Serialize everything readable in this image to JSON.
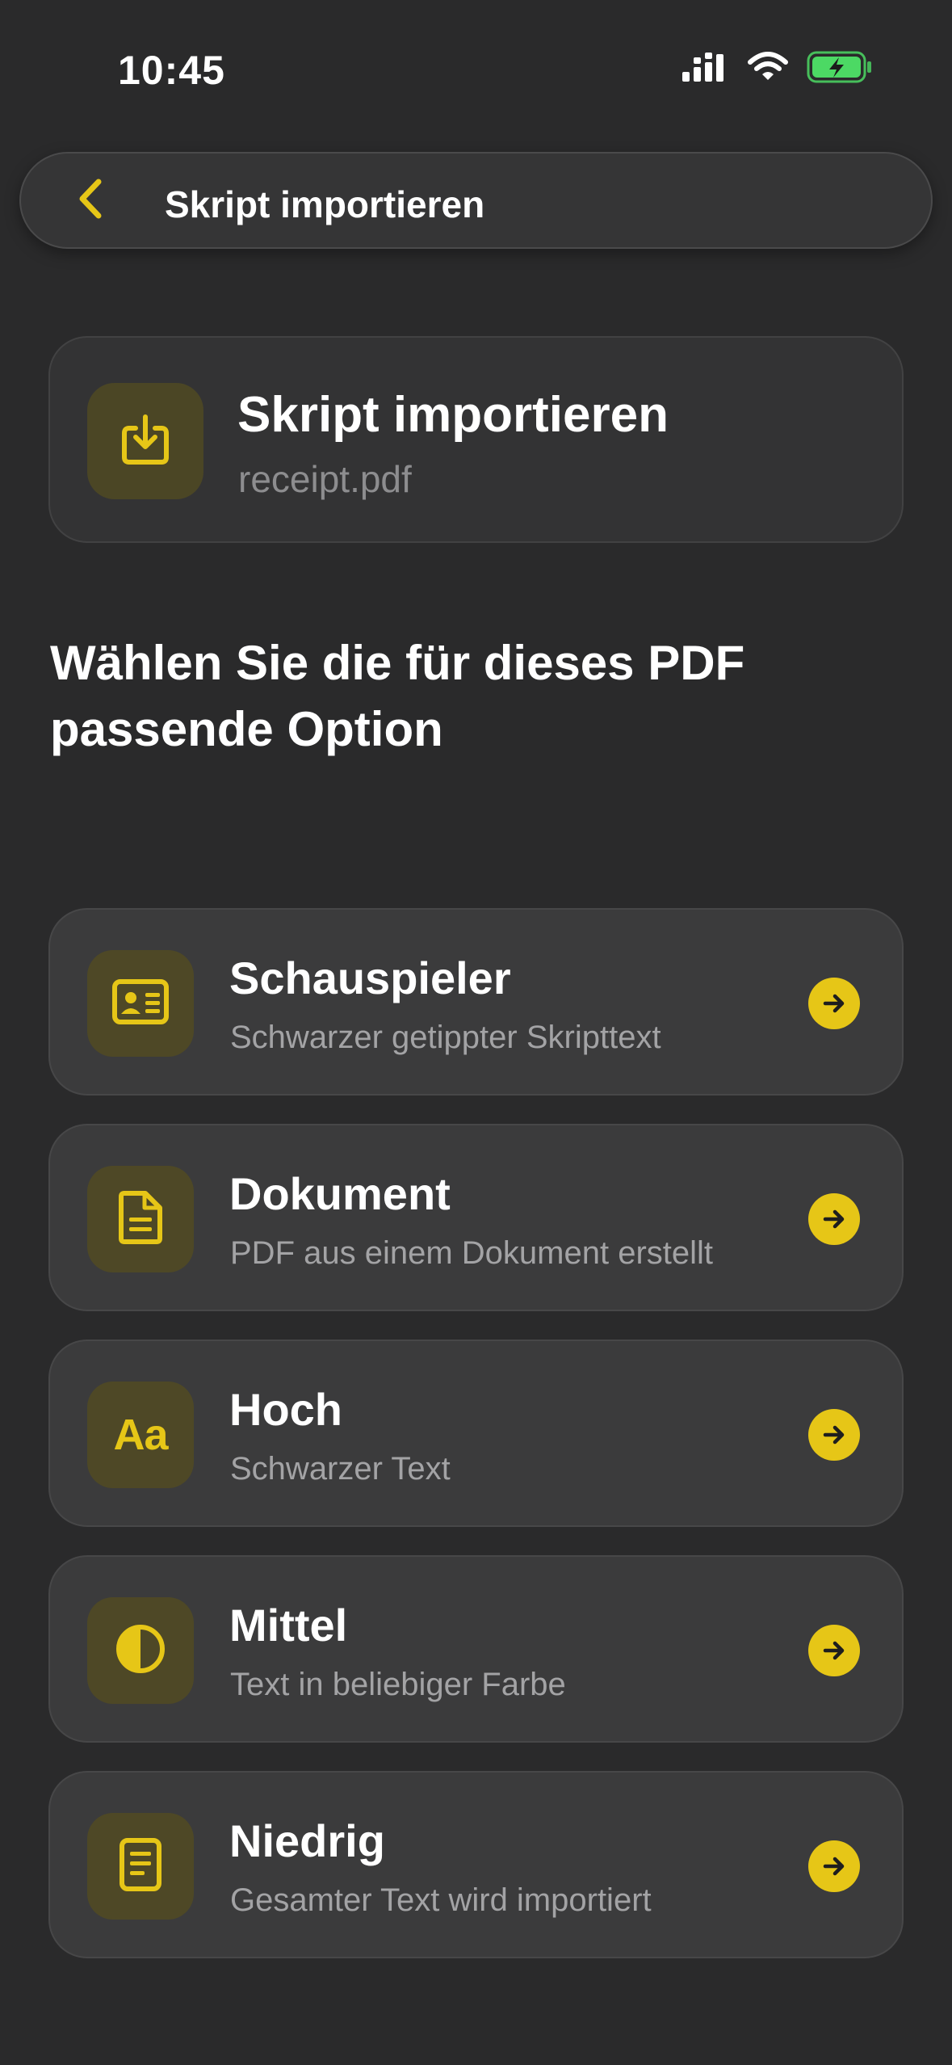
{
  "status_bar": {
    "time": "10:45"
  },
  "nav": {
    "title": "Skript importieren",
    "back_icon": "chevron-left-icon"
  },
  "file_card": {
    "title": "Skript importieren",
    "filename": "receipt.pdf",
    "icon": "import-download-icon"
  },
  "heading": "Wählen Sie die für dieses PDF passende Option",
  "options": [
    {
      "title": "Schauspieler",
      "subtitle": "Schwarzer getippter Skripttext",
      "icon": "id-card-icon"
    },
    {
      "title": "Dokument",
      "subtitle": "PDF aus einem Dokument erstellt",
      "icon": "document-icon"
    },
    {
      "title": "Hoch",
      "subtitle": "Schwarzer Text",
      "icon": "text-aa-icon",
      "icon_glyph": "Aa"
    },
    {
      "title": "Mittel",
      "subtitle": "Text in beliebiger Farbe",
      "icon": "contrast-icon"
    },
    {
      "title": "Niedrig",
      "subtitle": "Gesamter Text wird importiert",
      "icon": "page-lines-icon"
    }
  ],
  "colors": {
    "background": "#2a2a2b",
    "accent": "#e6c617",
    "card": "#3b3b3c",
    "icon_tile": "#4e4826",
    "subtitle": "#a3a3a5",
    "battery": "#4cd964"
  }
}
